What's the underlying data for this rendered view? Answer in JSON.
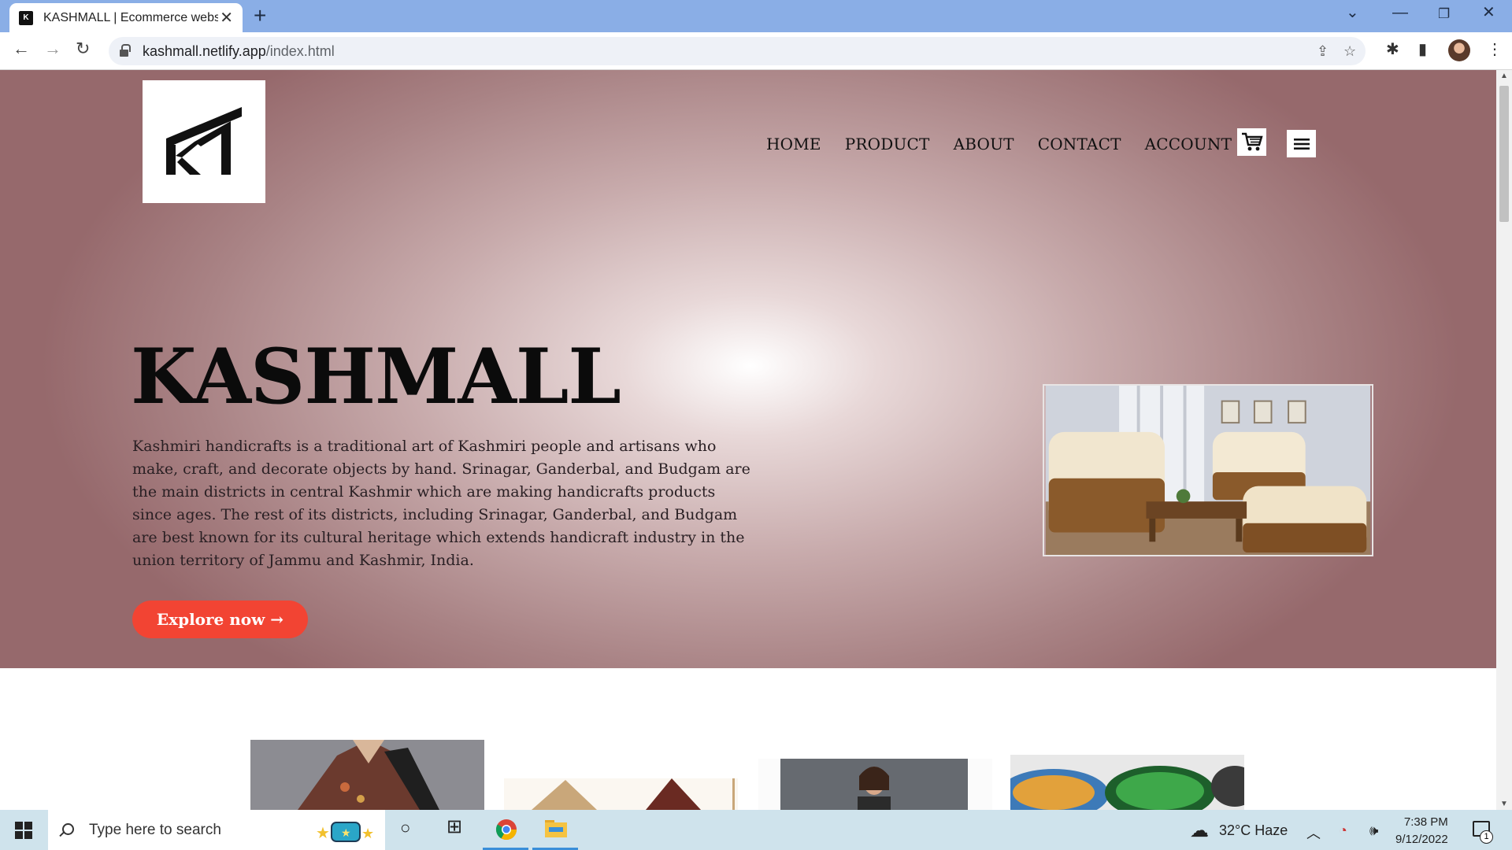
{
  "browser": {
    "tab_title": "KASHMALL | Ecommerce webs",
    "url_domain": "kashmall.netlify.app",
    "url_path": "/index.html"
  },
  "site": {
    "nav": [
      "HOME",
      "PRODUCT",
      "ABOUT",
      "CONTACT",
      "ACCOUNT"
    ],
    "hero_title": "KASHMALL",
    "hero_text": "Kashmiri handicrafts is a traditional art of Kashmiri people and artisans who make, craft, and decorate objects by hand. Srinagar, Ganderbal, and Budgam are the main districts in central Kashmir which are making handicrafts products since ages. The rest of its districts, including Srinagar, Ganderbal, and Budgam are best known for its cultural heritage which extends handicraft industry in the union territory of Jammu and Kashmir, India.",
    "cta_label": "Explore now →",
    "colors": {
      "accent": "#f24433",
      "hero_edge": "#96696c",
      "hero_center": "#ffffff"
    }
  },
  "taskbar": {
    "search_placeholder": "Type here to search",
    "weather": "32°C  Haze",
    "time": "7:38 PM",
    "date": "9/12/2022",
    "notification_count": "1"
  }
}
